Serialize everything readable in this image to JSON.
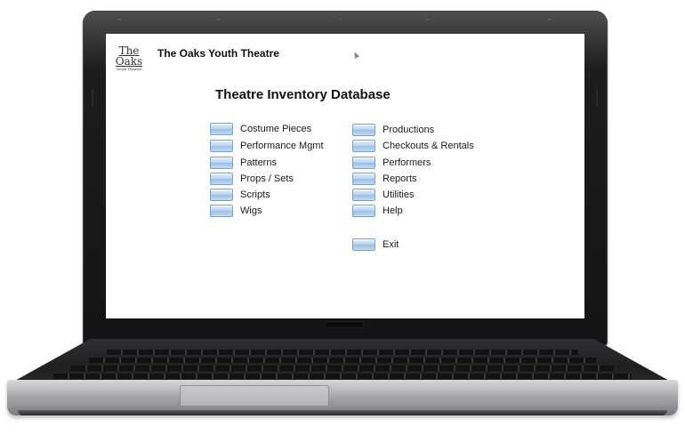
{
  "header": {
    "logo_name": "The Oaks",
    "logo_sub": "Youth Theatre",
    "app_title": "The Oaks Youth Theatre"
  },
  "main": {
    "title": "Theatre Inventory Database",
    "left_menu": [
      {
        "label": "Costume Pieces"
      },
      {
        "label": "Performance Mgmt"
      },
      {
        "label": "Patterns"
      },
      {
        "label": "Props / Sets"
      },
      {
        "label": "Scripts"
      },
      {
        "label": "Wigs"
      }
    ],
    "right_menu": [
      {
        "label": "Productions"
      },
      {
        "label": "Checkouts & Rentals"
      },
      {
        "label": "Performers"
      },
      {
        "label": "Reports"
      },
      {
        "label": "Utilities"
      },
      {
        "label": "Help"
      }
    ],
    "exit_label": "Exit"
  },
  "colors": {
    "button_fill": "#bcd6ee",
    "button_border": "#7f9fc2",
    "laptop_frame": "#1d1d1f",
    "laptop_base": "#a9aaad"
  }
}
